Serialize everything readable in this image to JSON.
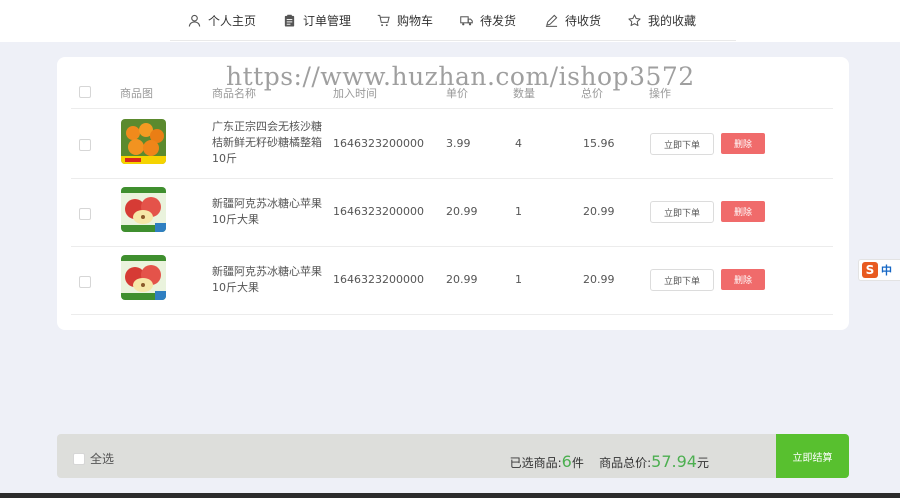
{
  "nav": {
    "items": [
      {
        "label": "个人主页",
        "icon": "user-icon"
      },
      {
        "label": "订单管理",
        "icon": "clipboard-icon"
      },
      {
        "label": "购物车",
        "icon": "cart-icon"
      },
      {
        "label": "待发货",
        "icon": "truck-icon"
      },
      {
        "label": "待收货",
        "icon": "pen-icon"
      },
      {
        "label": "我的收藏",
        "icon": "star-icon"
      }
    ]
  },
  "watermark": "https://www.huzhan.com/ishop3572",
  "table": {
    "headers": [
      "商品图",
      "商品名称",
      "加入时间",
      "单价",
      "数量",
      "总价",
      "操作"
    ],
    "rows": [
      {
        "name": "广东正宗四会无核沙糖桔新鲜无籽砂糖橘整箱10斤",
        "time": "1646323200000",
        "price": "3.99",
        "qty": "4",
        "total": "15.96",
        "image": "orange-image"
      },
      {
        "name": "新疆阿克苏冰糖心苹果10斤大果",
        "time": "1646323200000",
        "price": "20.99",
        "qty": "1",
        "total": "20.99",
        "image": "apple-image"
      },
      {
        "name": "新疆阿克苏冰糖心苹果10斤大果",
        "time": "1646323200000",
        "price": "20.99",
        "qty": "1",
        "total": "20.99",
        "image": "apple-image"
      }
    ],
    "order_label": "立即下单",
    "delete_label": "删除"
  },
  "footer": {
    "select_all": "全选",
    "selected_prefix": "已选商品:",
    "selected_count": "6",
    "selected_unit": "件",
    "total_prefix": "商品总价:",
    "total_value": "57.94",
    "total_unit": "元",
    "checkout_label": "立即结算"
  },
  "ime": {
    "logo": "S",
    "mode": "中"
  },
  "colors": {
    "accent_green": "#58c02f",
    "delete_red": "#f06b6b",
    "price_green": "#4caf50"
  }
}
